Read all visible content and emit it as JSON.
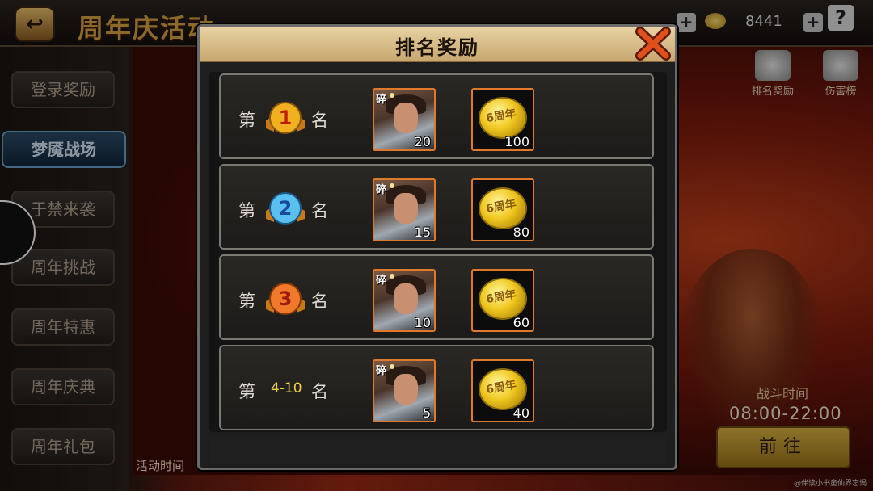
{
  "topbar": {
    "back_icon": "back-arrow-icon",
    "event_title": "周年庆活动",
    "resource_value": "8441",
    "help_label": "?"
  },
  "side_menu": {
    "items": [
      {
        "label": "登录奖励",
        "active": false
      },
      {
        "label": "梦魇战场",
        "active": true
      },
      {
        "label": "于禁来袭",
        "active": false
      },
      {
        "label": "周年挑战",
        "active": false
      },
      {
        "label": "周年特惠",
        "active": false
      },
      {
        "label": "周年庆典",
        "active": false
      },
      {
        "label": "周年礼包",
        "active": false
      }
    ]
  },
  "right_panel": {
    "icons": [
      {
        "label": "排名奖励",
        "icon": "ranking-reward-icon"
      },
      {
        "label": "伤害榜",
        "icon": "damage-board-icon"
      }
    ],
    "battle_time_label": "战斗时间",
    "battle_time": "08:00-22:00",
    "go_button": "前往",
    "activity_time_label": "活动时间"
  },
  "modal": {
    "title": "排名奖励",
    "close_icon": "close-x-icon",
    "rank_prefix": "第",
    "rank_suffix": "名",
    "fragment_tag": "碎",
    "rows": [
      {
        "rank": "1",
        "medal_color": "#e8a020",
        "hero_fragments": "20",
        "coins": "100"
      },
      {
        "rank": "2",
        "medal_color": "#2aa0e0",
        "hero_fragments": "15",
        "coins": "80"
      },
      {
        "rank": "3",
        "medal_color": "#e06a1a",
        "hero_fragments": "10",
        "coins": "60"
      },
      {
        "rank": "4-10",
        "medal_color": null,
        "hero_fragments": "5",
        "coins": "40"
      }
    ],
    "coin_label": "6周年"
  },
  "watermark": "@伴读小书童仙界忘谒"
}
